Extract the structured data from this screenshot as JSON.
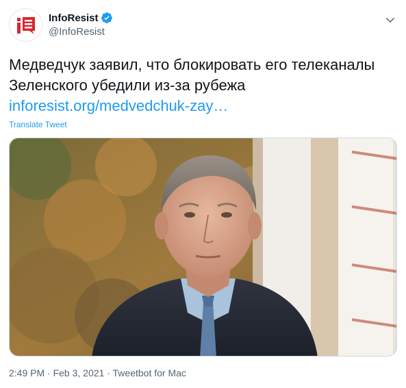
{
  "author": {
    "display_name": "InfoResist",
    "handle": "@InfoResist",
    "avatar_icon": "inforesist-logo-icon",
    "verified_icon": "verified-badge-icon"
  },
  "tweet": {
    "text_line_1": "Медведчук заявил, что блокировать его телеканалы",
    "text_line_2": "Зеленского убедили из-за рубежа",
    "link_text": "inforesist.org/medvedchuk-zay…",
    "translate_label": "Translate Tweet"
  },
  "media": {
    "alt": "Photo of a man in a dark suit and light blue shirt"
  },
  "footer": {
    "time": "2:49 PM",
    "separator_1": " · ",
    "date": "Feb 3, 2021",
    "separator_2": " · ",
    "source": "Tweetbot for Mac"
  },
  "colors": {
    "link": "#1d9bf0",
    "muted": "#536471",
    "text": "#0f1419",
    "brand_red": "#d7282f"
  }
}
